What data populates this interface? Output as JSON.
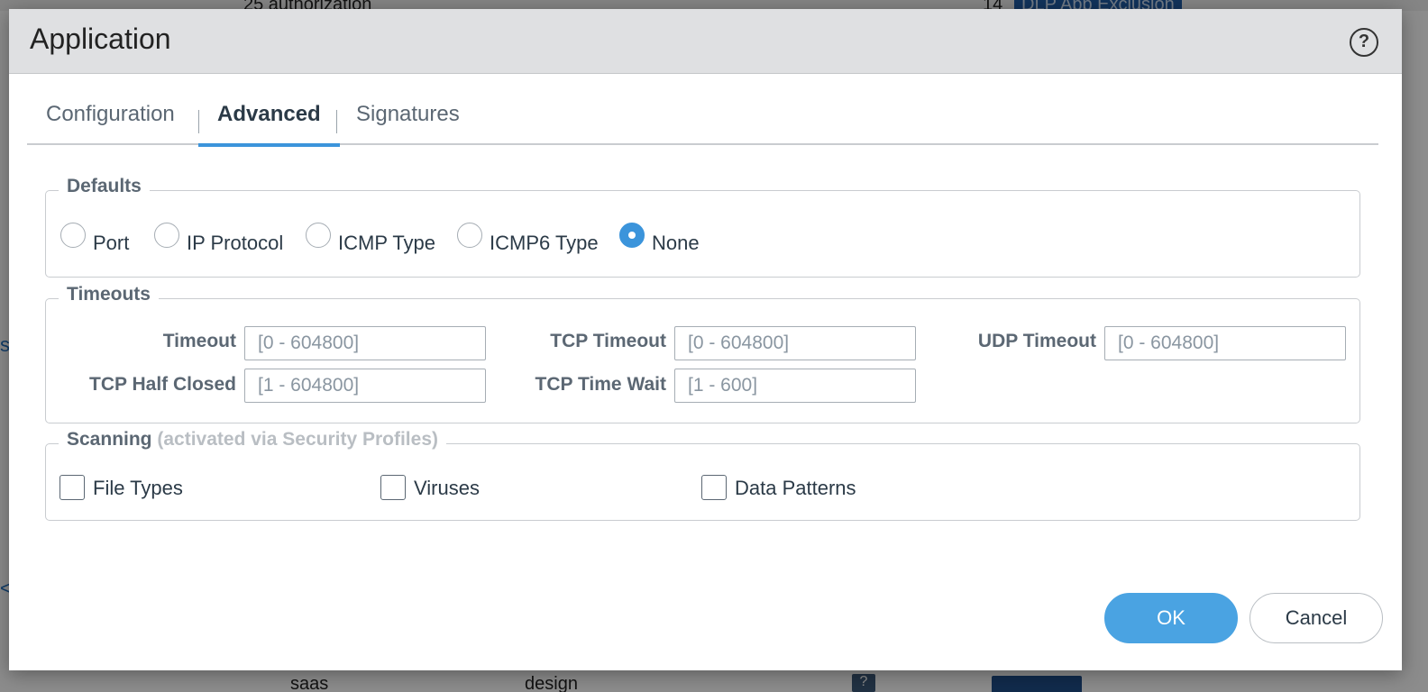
{
  "background": {
    "top_text_1": "25 authorization",
    "top_text_2": "14",
    "top_badge": "DLP App Exclusion",
    "bottom_text_1": "saas",
    "bottom_text_2": "design",
    "bottom_qmark": "?"
  },
  "dialog": {
    "title": "Application",
    "help_icon": "question-circle-icon",
    "tabs": [
      {
        "label": "Configuration",
        "active": false
      },
      {
        "label": "Advanced",
        "active": true
      },
      {
        "label": "Signatures",
        "active": false
      }
    ],
    "defaults": {
      "legend": "Defaults",
      "options": [
        {
          "label": "Port",
          "checked": false
        },
        {
          "label": "IP Protocol",
          "checked": false
        },
        {
          "label": "ICMP Type",
          "checked": false
        },
        {
          "label": "ICMP6 Type",
          "checked": false
        },
        {
          "label": "None",
          "checked": true
        }
      ]
    },
    "timeouts": {
      "legend": "Timeouts",
      "fields": [
        {
          "label": "Timeout",
          "placeholder": "[0 - 604800]",
          "value": ""
        },
        {
          "label": "TCP Timeout",
          "placeholder": "[0 - 604800]",
          "value": ""
        },
        {
          "label": "UDP Timeout",
          "placeholder": "[0 - 604800]",
          "value": ""
        },
        {
          "label": "TCP Half Closed",
          "placeholder": "[1 - 604800]",
          "value": ""
        },
        {
          "label": "TCP Time Wait",
          "placeholder": "[1 - 600]",
          "value": ""
        }
      ]
    },
    "scanning": {
      "legend": "Scanning",
      "legend_note": "(activated via Security Profiles)",
      "checkboxes": [
        {
          "label": "File Types",
          "checked": false
        },
        {
          "label": "Viruses",
          "checked": false
        },
        {
          "label": "Data Patterns",
          "checked": false
        }
      ]
    },
    "buttons": {
      "ok": "OK",
      "cancel": "Cancel"
    }
  },
  "colors": {
    "accent": "#3b94db",
    "ok_button": "#4aa3e2",
    "header_bg": "#dfe0e2",
    "label_text": "#5b6773"
  }
}
